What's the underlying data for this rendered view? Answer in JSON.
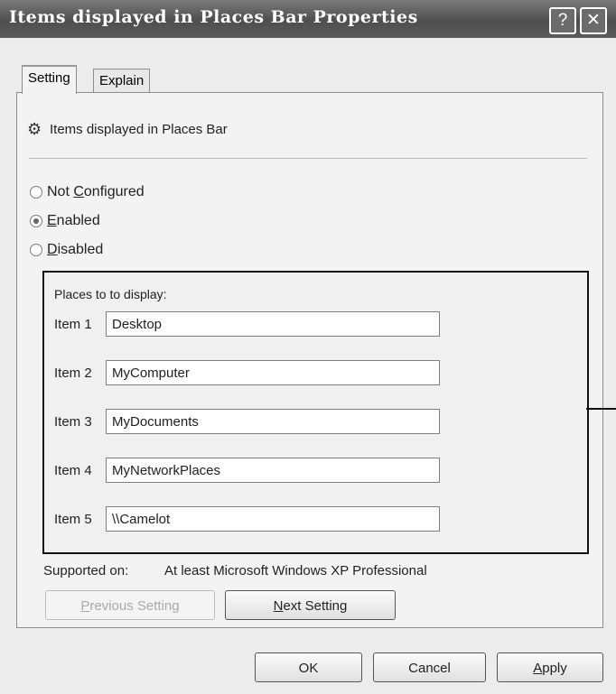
{
  "window": {
    "title": "Items displayed in Places Bar Properties",
    "help_glyph": "?",
    "close_glyph": "✕"
  },
  "tabs": [
    {
      "label": "Setting",
      "active": true
    },
    {
      "label": "Explain",
      "active": false
    }
  ],
  "setting": {
    "heading": "Items displayed in Places Bar",
    "heading_icon": "policy-setting-icon",
    "radios": [
      {
        "prefix": "Not ",
        "accel": "C",
        "rest": "onfigured",
        "label": "Not Configured",
        "selected": false
      },
      {
        "prefix": "",
        "accel": "E",
        "rest": "nabled",
        "label": "Enabled",
        "selected": true
      },
      {
        "prefix": "",
        "accel": "D",
        "rest": "isabled",
        "label": "Disabled",
        "selected": false
      }
    ],
    "places_label": "Places to to display:",
    "items": [
      {
        "label": "Item 1",
        "value": "Desktop"
      },
      {
        "label": "Item 2",
        "value": "MyComputer"
      },
      {
        "label": "Item 3",
        "value": "MyDocuments"
      },
      {
        "label": "Item 4",
        "value": "MyNetworkPlaces"
      },
      {
        "label": "Item 5",
        "value": "\\\\Camelot"
      }
    ],
    "supported_label": "Supported on:",
    "supported_value": "At least Microsoft Windows XP Professional",
    "prev_button": {
      "accel": "P",
      "rest": "revious Setting",
      "enabled": false
    },
    "next_button": {
      "accel": "N",
      "rest": "ext Setting",
      "enabled": true
    }
  },
  "footer": {
    "ok_label": "OK",
    "cancel_label": "Cancel",
    "apply_accel": "A",
    "apply_rest": "pply"
  }
}
